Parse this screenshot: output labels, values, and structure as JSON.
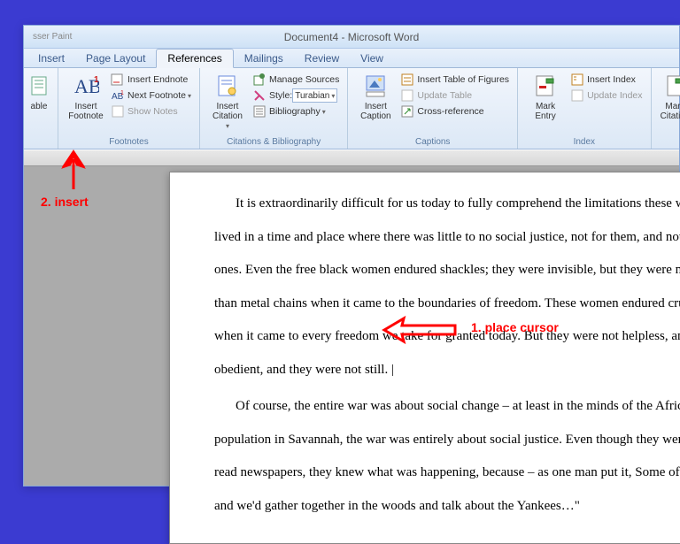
{
  "window": {
    "title": "Document4 - Microsoft Word",
    "hint": "sser    Paint"
  },
  "tabs": {
    "insert": "Insert",
    "pagelayout": "Page Layout",
    "references": "References",
    "mailings": "Mailings",
    "review": "Review",
    "view": "View"
  },
  "ribbon": {
    "toc": {
      "able": "able"
    },
    "footnotes": {
      "insert_footnote": "Insert\nFootnote",
      "insert_endnote": "Insert Endnote",
      "next_footnote": "Next Footnote",
      "show_notes": "Show Notes",
      "group": "Footnotes"
    },
    "citations": {
      "insert_citation": "Insert\nCitation",
      "manage_sources": "Manage Sources",
      "style_label": "Style:",
      "style_value": "Turabian",
      "bibliography": "Bibliography",
      "group": "Citations & Bibliography"
    },
    "captions": {
      "insert_caption": "Insert\nCaption",
      "insert_tof": "Insert Table of Figures",
      "update_table": "Update Table",
      "cross_ref": "Cross-reference",
      "group": "Captions"
    },
    "index": {
      "mark_entry": "Mark\nEntry",
      "insert_index": "Insert Index",
      "update_index": "Update Index",
      "group": "Index"
    },
    "toa": {
      "mark_citation": "Mark\nCitation"
    }
  },
  "document": {
    "p1l1": "It is extraordinarily difficult for us today to fully comprehend the limitations these wo",
    "p1l2": "lived in a time and place where there was little to no social justice, not for them, and not fo",
    "p1l3": "ones. Even the free black women endured shackles;  they were invisible, but they were no l",
    "p1l4": "than metal chains when it came to the boundaries  of freedom.  These women endured crue",
    "p1l5": "when it came to every freedom we take for granted today. But they were not helpless, and t",
    "p1l6": "obedient, and they were not still.",
    "p2l1": "Of course, the entire war was about social change – at least in the minds of the Africa",
    "p2l2": "population in Savannah, the war was entirely about social justice. Even though they were n",
    "p2l3": "read newspapers, they knew what was happening, because – as one man put it, Some of us",
    "p2l4": "and we'd gather together in the woods and talk about the Yankees…\""
  },
  "annotations": {
    "insert": "2. insert",
    "cursor": "1. place cursor"
  }
}
